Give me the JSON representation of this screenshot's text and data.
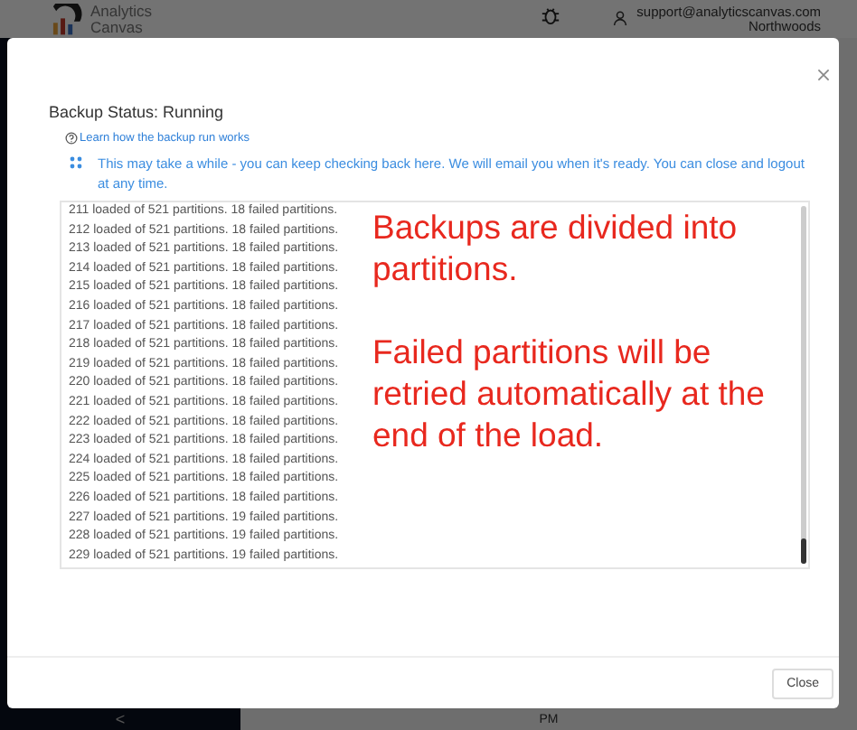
{
  "app_header": {
    "logo_text": [
      "Analytics",
      "Canvas"
    ],
    "user_email": "support@analyticscanvas.com",
    "organization": "Northwoods"
  },
  "background": {
    "sidebar_toggle": "<",
    "content_text": "PM"
  },
  "dialog": {
    "status": "Backup Status: Running",
    "help_link": "Learn how the backup run works",
    "info": "This may take a while - you can keep checking back here. We will email you when it's ready. You can close and logout at any time.",
    "log_lines": [
      "211 loaded of 521 partitions. 18 failed partitions.",
      "212 loaded of 521 partitions. 18 failed partitions.",
      "213 loaded of 521 partitions. 18 failed partitions.",
      "214 loaded of 521 partitions. 18 failed partitions.",
      "215 loaded of 521 partitions. 18 failed partitions.",
      "216 loaded of 521 partitions. 18 failed partitions.",
      "217 loaded of 521 partitions. 18 failed partitions.",
      "218 loaded of 521 partitions. 18 failed partitions.",
      "219 loaded of 521 partitions. 18 failed partitions.",
      "220 loaded of 521 partitions. 18 failed partitions.",
      "221 loaded of 521 partitions. 18 failed partitions.",
      "222 loaded of 521 partitions. 18 failed partitions.",
      "223 loaded of 521 partitions. 18 failed partitions.",
      "224 loaded of 521 partitions. 18 failed partitions.",
      "225 loaded of 521 partitions. 18 failed partitions.",
      "226 loaded of 521 partitions. 18 failed partitions.",
      "227 loaded of 521 partitions. 19 failed partitions.",
      "228 loaded of 521 partitions. 19 failed partitions.",
      "229 loaded of 521 partitions. 19 failed partitions."
    ],
    "annotation": [
      "Backups are divided into partitions.",
      "Failed partitions will be retried automatically at the end of the load."
    ],
    "close_button": "Close"
  }
}
